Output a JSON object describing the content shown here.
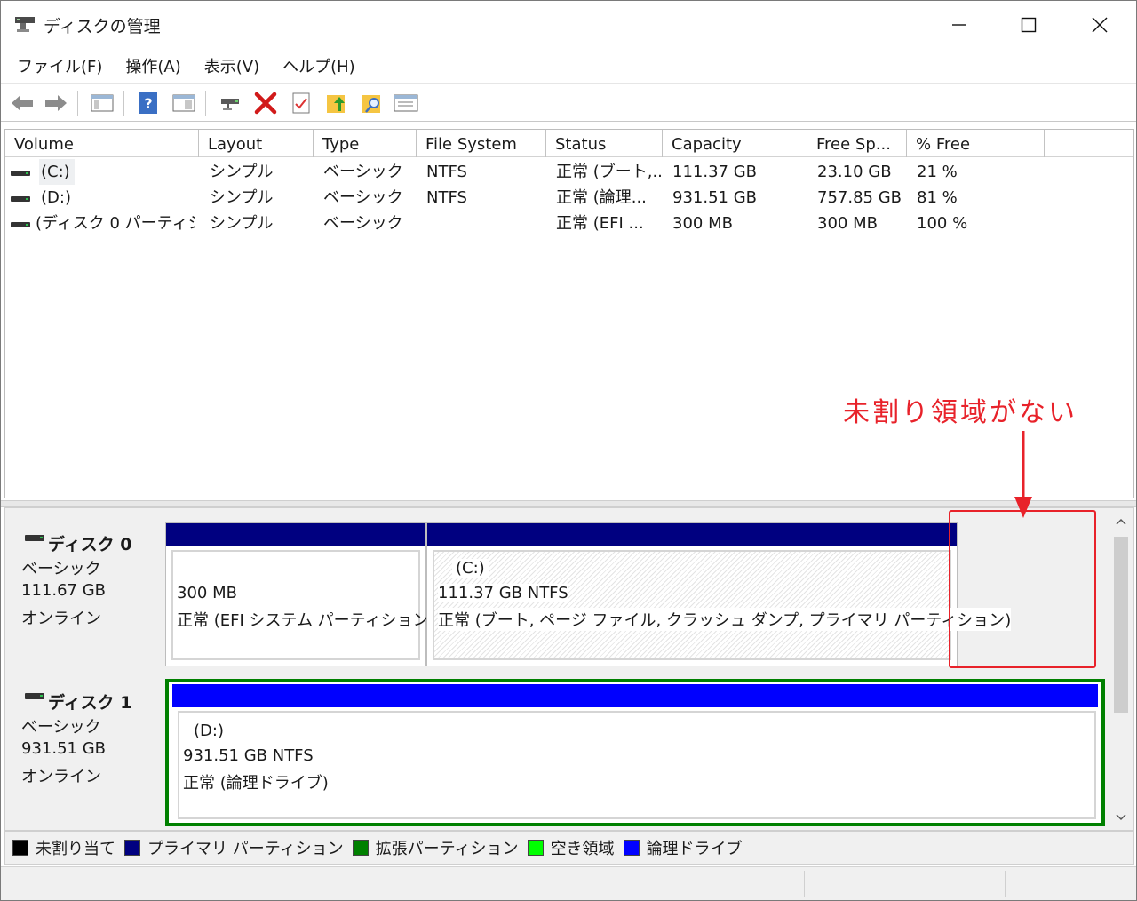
{
  "window": {
    "title": "ディスクの管理"
  },
  "menu": [
    "ファイル(F)",
    "操作(A)",
    "表示(V)",
    "ヘルプ(H)"
  ],
  "toolbar": {
    "icons": [
      "back-arrow-icon",
      "forward-arrow-icon",
      "console-tree-icon",
      "help-icon",
      "show-pane-icon",
      "connect-drive-icon",
      "delete-icon",
      "check-icon",
      "folder-up-icon",
      "search-folder-icon",
      "properties-icon"
    ]
  },
  "list": {
    "columns": [
      "Volume",
      "Layout",
      "Type",
      "File System",
      "Status",
      "Capacity",
      "Free Sp...",
      "% Free"
    ],
    "rows": [
      {
        "volume": "(C:)",
        "layout": "シンプル",
        "type": "ベーシック",
        "fs": "NTFS",
        "status": "正常 (ブート,...",
        "capacity": "111.37 GB",
        "free": "23.10 GB",
        "pct": "21 %"
      },
      {
        "volume": "(D:)",
        "layout": "シンプル",
        "type": "ベーシック",
        "fs": "NTFS",
        "status": "正常 (論理...",
        "capacity": "931.51 GB",
        "free": "757.85 GB",
        "pct": "81 %"
      },
      {
        "volume": "(ディスク 0 パーティショ...",
        "layout": "シンプル",
        "type": "ベーシック",
        "fs": "",
        "status": "正常 (EFI ...",
        "capacity": "300 MB",
        "free": "300 MB",
        "pct": "100 %"
      }
    ]
  },
  "annotation": {
    "text": "未割り領域がない",
    "color": "#e8222a"
  },
  "disks": [
    {
      "name": "ディスク 0",
      "type": "ベーシック",
      "size": "111.67 GB",
      "state": "オンライン",
      "partitions": [
        {
          "label": "",
          "size": "300 MB",
          "status": "正常 (EFI システム パーティション)",
          "bar_color": "#000080"
        },
        {
          "label": "(C:)",
          "size": "111.37 GB NTFS",
          "status": "正常 (ブート, ページ ファイル, クラッシュ ダンプ, プライマリ パーティション)",
          "bar_color": "#000080"
        }
      ]
    },
    {
      "name": "ディスク 1",
      "type": "ベーシック",
      "size": "931.51 GB",
      "state": "オンライン",
      "partitions": [
        {
          "label": "(D:)",
          "size": "931.51 GB NTFS",
          "status": "正常 (論理ドライブ)",
          "bar_color": "#0000ff",
          "frame_color": "#008000"
        }
      ]
    }
  ],
  "legend": [
    {
      "label": "未割り当て",
      "color": "#000000"
    },
    {
      "label": "プライマリ パーティション",
      "color": "#000080"
    },
    {
      "label": "拡張パーティション",
      "color": "#008000"
    },
    {
      "label": "空き領域",
      "color": "#00ff00"
    },
    {
      "label": "論理ドライブ",
      "color": "#0000ff"
    }
  ]
}
